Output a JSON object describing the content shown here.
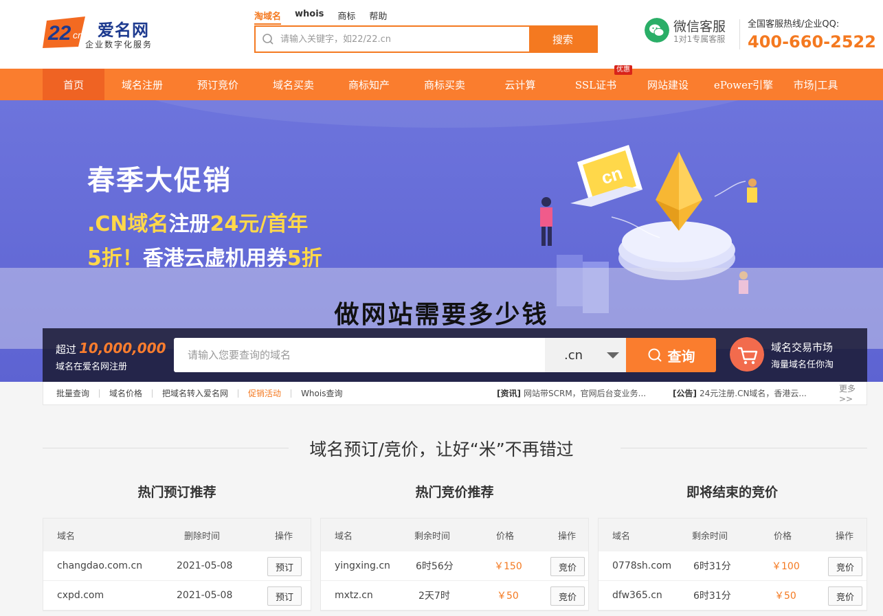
{
  "header": {
    "logo": {
      "mark": "22cn",
      "name": "爱名网",
      "slogan": "企业数字化服务"
    },
    "search_tabs": [
      "淘域名",
      "whois",
      "商标",
      "帮助"
    ],
    "search_placeholder": "请输入关键字，如22/22.cn",
    "search_button": "搜索",
    "wechat": {
      "title": "微信客服",
      "subtitle": "1对1专属客服"
    },
    "hotline": {
      "label": "全国客服热线/企业QQ:",
      "number": "400-660-2522"
    }
  },
  "nav": {
    "items": [
      "首页",
      "域名注册",
      "预订竞价",
      "域名买卖",
      "商标知产",
      "商标买卖",
      "云计算",
      "SSL证书",
      "网站建设",
      "ePower引擎",
      "市场|工具"
    ],
    "badge": "优惠"
  },
  "banner": {
    "title": "春季大促销",
    "line2": {
      "p1": ".CN域名",
      "p2": "注册",
      "p3": "24元/首年"
    },
    "line3": {
      "p1": "5折！",
      "p2": "香港云虚机用券",
      "p3": "5折"
    },
    "page_title": "做网站需要多少钱"
  },
  "domain_search": {
    "left_line1": "超过",
    "left_count": "10,000,000",
    "left_line2": "域名在爱名网注册",
    "placeholder": "请输入您要查询的域名",
    "suffix": ".cn",
    "button": "查询",
    "market_title": "域名交易市场",
    "market_sub": "海量域名任你淘"
  },
  "quick_links": {
    "items": [
      "批量查询",
      "域名价格",
      "把域名转入爱名网",
      "促销活动",
      "Whois查询"
    ],
    "news1_tag": "[资讯]",
    "news1_text": "网站带SCRM，官网后台变业务...",
    "news2_tag": "[公告]",
    "news2_text": "24元注册.CN域名，香港云...",
    "more": "更多>>"
  },
  "section": {
    "title": "域名预订/竞价，让好“米”不再错过",
    "col1": {
      "title": "热门预订推荐",
      "headers": [
        "域名",
        "删除时间",
        "操作"
      ],
      "rows": [
        {
          "domain": "changdao.com.cn",
          "time": "2021-05-08",
          "op": "预订"
        },
        {
          "domain": "cxpd.com",
          "time": "2021-05-08",
          "op": "预订"
        }
      ]
    },
    "col2": {
      "title": "热门竞价推荐",
      "headers": [
        "域名",
        "剩余时间",
        "价格",
        "操作"
      ],
      "rows": [
        {
          "domain": "yingxing.cn",
          "time": "6时56分",
          "price": "￥150",
          "op": "竞价"
        },
        {
          "domain": "mxtz.cn",
          "time": "2天7时",
          "price": "￥50",
          "op": "竞价"
        }
      ]
    },
    "col3": {
      "title": "即将结束的竞价",
      "headers": [
        "域名",
        "剩余时间",
        "价格",
        "操作"
      ],
      "rows": [
        {
          "domain": "0778sh.com",
          "time": "6时31分",
          "price": "￥100",
          "op": "竞价"
        },
        {
          "domain": "dfw365.cn",
          "time": "6时31分",
          "price": "￥50",
          "op": "竞价"
        }
      ]
    }
  },
  "colors": {
    "accent": "#fa7d2e",
    "banner": "#6269d6",
    "price": "#f47920"
  }
}
